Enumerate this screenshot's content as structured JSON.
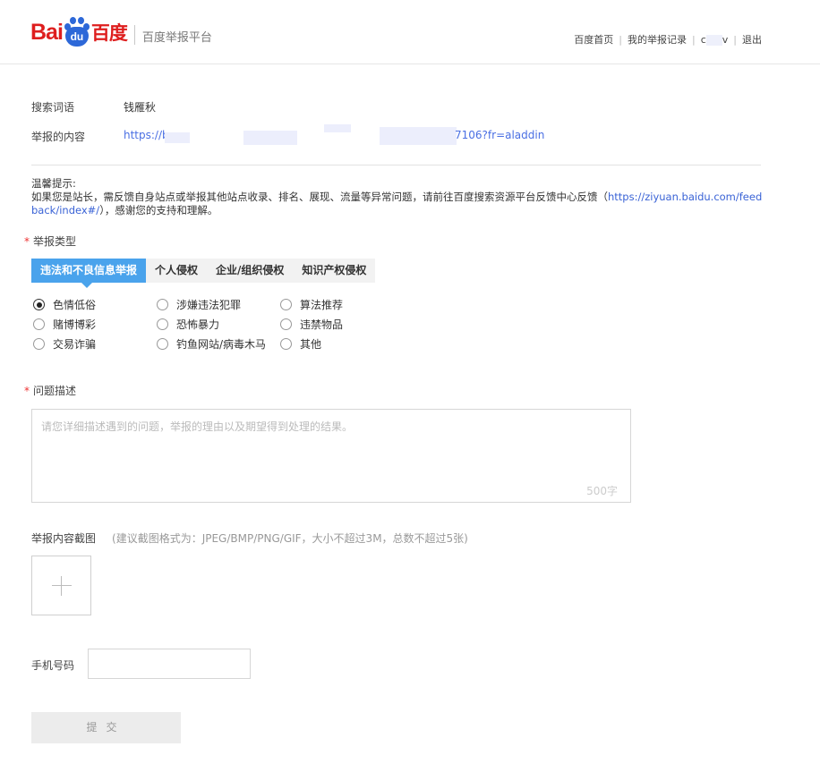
{
  "header": {
    "logo_bai": "Bai",
    "logo_du": "du",
    "logo_cn": "百度",
    "platform": "百度举报平台",
    "nav": {
      "home": "百度首页",
      "records": "我的举报记录",
      "user_prefix": "c",
      "user_suffix": "v",
      "logout": "退出"
    }
  },
  "info": {
    "search_label": "搜索词语",
    "search_value": "钱雁秋",
    "content_label": "举报的内容",
    "url_start": "https://ba",
    "url_end": "7106?fr=aladdin"
  },
  "tip": {
    "title": "温馨提示:",
    "text_before": "如果您是站长，需反馈自身站点或举报其他站点收录、排名、展现、流量等异常问题，请前往百度搜索资源平台反馈中心反馈（",
    "link": "https://ziyuan.baidu.com/feedback/index#/",
    "text_after": "），感谢您的支持和理解。"
  },
  "report_type": {
    "label": "举报类型",
    "tabs": [
      "违法和不良信息举报",
      "个人侵权",
      "企业/组织侵权",
      "知识产权侵权"
    ],
    "active_tab": 0,
    "options": [
      "色情低俗",
      "涉嫌违法犯罪",
      "算法推荐",
      "赌博博彩",
      "恐怖暴力",
      "违禁物品",
      "交易诈骗",
      "钓鱼网站/病毒木马",
      "其他"
    ],
    "selected": "色情低俗"
  },
  "description": {
    "label": "问题描述",
    "placeholder": "请您详细描述遇到的问题，举报的理由以及期望得到处理的结果。",
    "counter": "500字"
  },
  "screenshot": {
    "label": "举报内容截图",
    "hint": "(建议截图格式为：JPEG/BMP/PNG/GIF，大小不超过3M，总数不超过5张)"
  },
  "phone": {
    "label": "手机号码",
    "value": ""
  },
  "submit_label": "提交",
  "colors": {
    "brand_red": "#de1e1e",
    "brand_blue": "#2d68d8",
    "active_tab": "#4aa3ec",
    "link": "#4a6fe3"
  }
}
